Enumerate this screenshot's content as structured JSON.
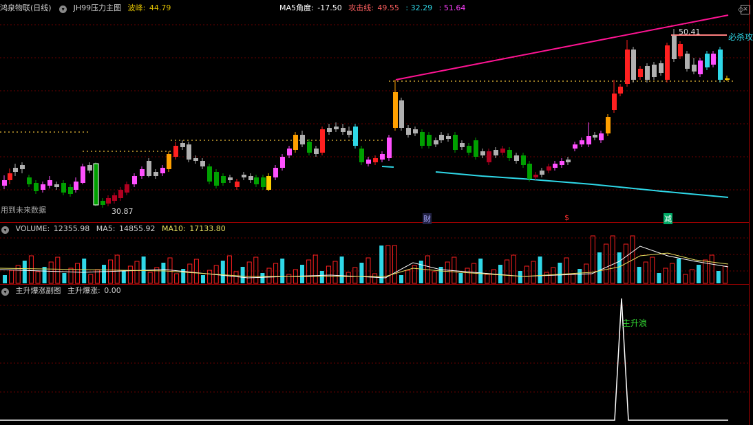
{
  "main_panel": {
    "title": "鸿泉物联(日线)",
    "indicator_name": "JH99压力主图",
    "wave_peak_label": "波峰:",
    "wave_peak_value": "44.79",
    "ma5_angle_label": "MA5角度:",
    "ma5_angle_value": "-17.50",
    "attack_line_label": "攻击线:",
    "attack_line_value": "49.55",
    "value2": ": 32.29",
    "value3": ": 51.64",
    "high_marker": "50.41",
    "low_marker": "30.87",
    "must_attack": "必杀攻",
    "future_data_note": "用到未来数据",
    "signal_cai": "财",
    "signal_dollar": "$",
    "signal_jian": "减"
  },
  "volume_panel": {
    "volume_label": "VOLUME:",
    "volume_value": "12355.98",
    "ma5_label": "MA5:",
    "ma5_value": "14855.92",
    "ma10_label": "MA10:",
    "ma10_value": "17133.80"
  },
  "sub_panel": {
    "title": "主升爆涨副图",
    "series_label": "主升爆涨:",
    "series_value": "0.00",
    "spike_label": "主升浪"
  },
  "colors": {
    "up": "#ff3c3c",
    "down": "#00e0e0",
    "grid": "#7a0000",
    "pink_line": "#ff1493",
    "cyan_line": "#2fd8e8",
    "gold_dots": "#c8a030"
  }
}
